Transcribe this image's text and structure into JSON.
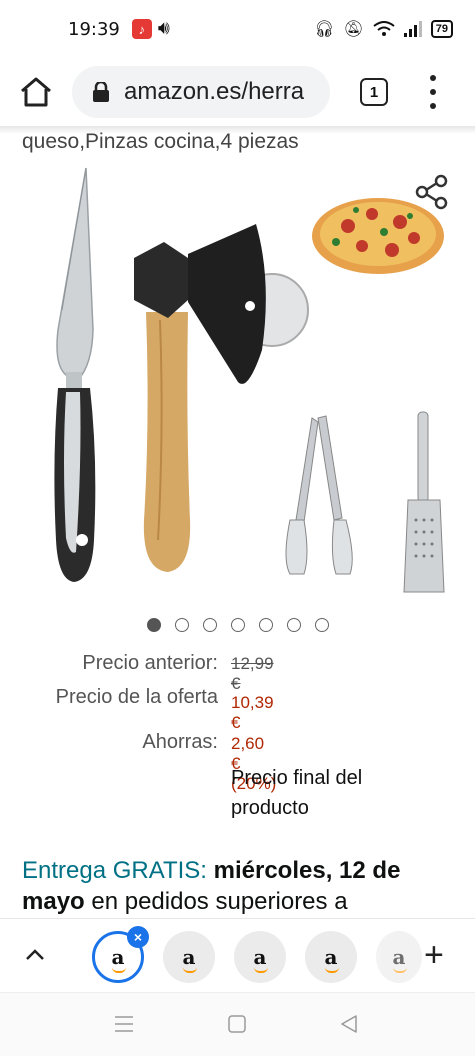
{
  "status": {
    "time": "19:39",
    "battery": "79"
  },
  "browser": {
    "url": "amazon.es/herra",
    "tab_count": "1"
  },
  "product": {
    "title_snippet": "queso,Pinzas cocina,4 piezas",
    "image_count": 7,
    "active_image": 0
  },
  "pricing": {
    "previous_label": "Precio anterior:",
    "previous_value": "12,99 €",
    "deal_label": "Precio de la oferta",
    "deal_value": "10,39 €",
    "savings_label": "Ahorras:",
    "savings_value": "2,60 € (20%)",
    "final_note_1": "Precio final del",
    "final_note_2": "producto"
  },
  "delivery": {
    "prefix": "Entrega GRATIS:",
    "date": "miércoles, 12 de mayo",
    "date_part1": "miércoles, 12 de",
    "date_part2": "mayo",
    "suffix": "en pedidos superiores a"
  },
  "tabs": {
    "items": [
      {
        "icon": "a",
        "active": true
      },
      {
        "icon": "a",
        "active": false
      },
      {
        "icon": "a",
        "active": false
      },
      {
        "icon": "a",
        "active": false
      },
      {
        "icon": "a",
        "active": false
      }
    ]
  },
  "colors": {
    "accent": "#1a73e8",
    "price_red": "#b12704",
    "teal": "#007185",
    "amazon_orange": "#ff9900"
  }
}
